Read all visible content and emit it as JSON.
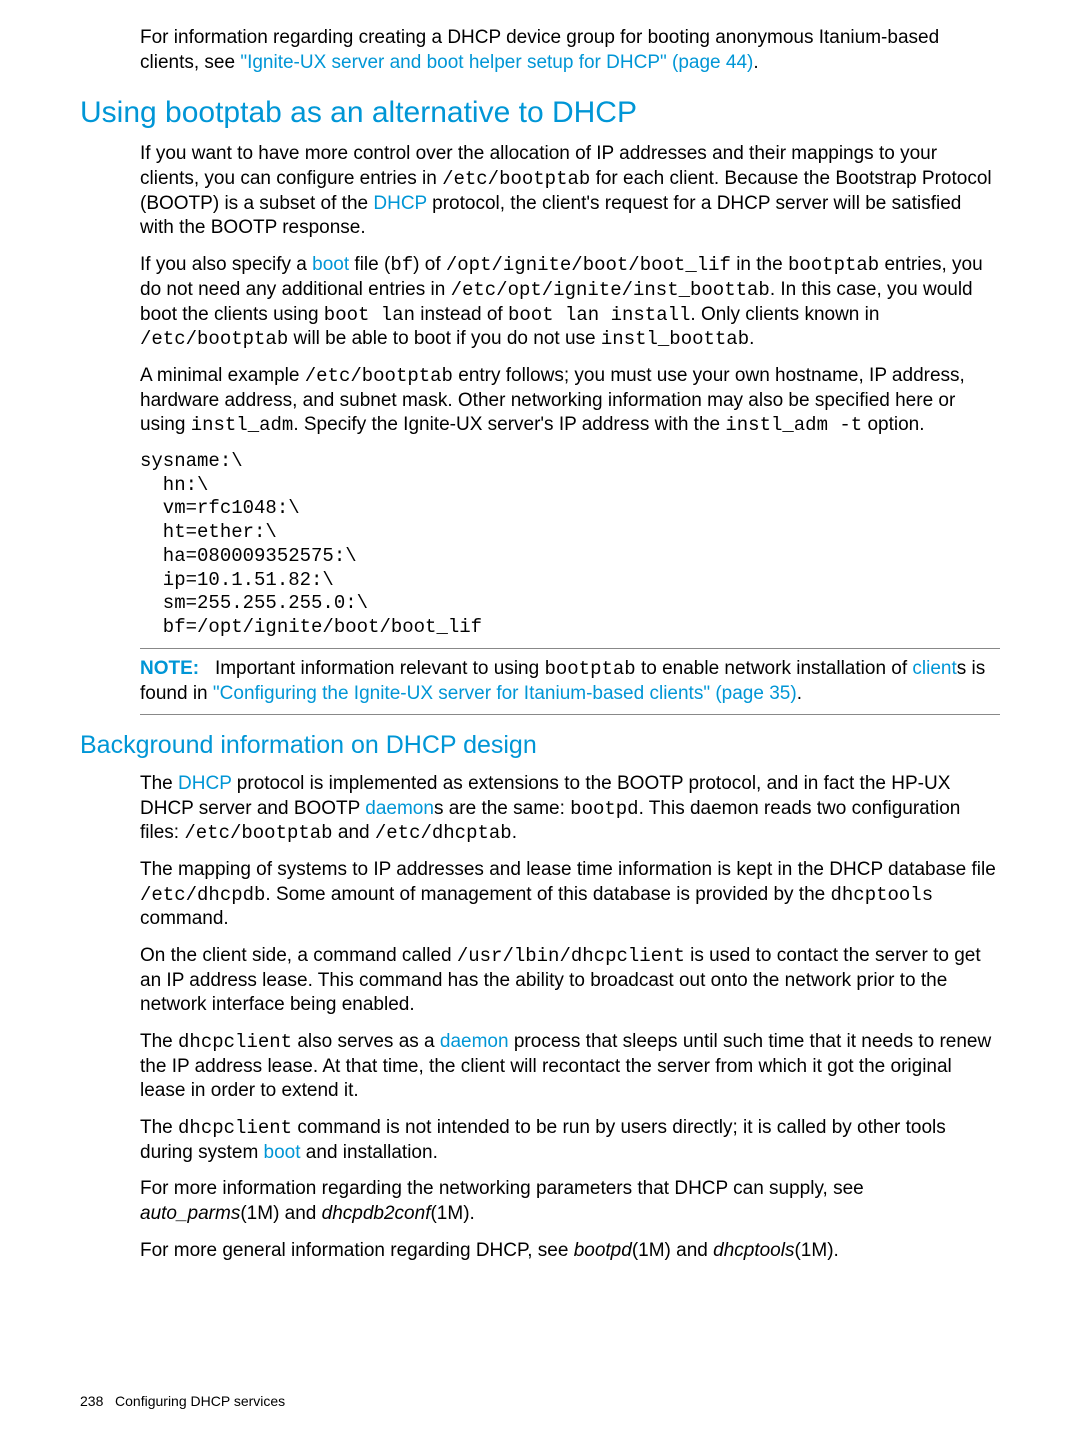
{
  "intro": {
    "p1_a": "For information regarding creating a DHCP device group for booting anonymous Itanium-based clients, see ",
    "p1_link": "\"Ignite-UX server and boot helper setup for DHCP\" (page 44)",
    "p1_b": "."
  },
  "section1": {
    "heading": "Using bootptab as an alternative to DHCP",
    "p1_a": "If you want to have more control over the allocation of IP addresses and their mappings to your clients, you can configure entries in ",
    "p1_code1": "/etc/bootptab",
    "p1_b": " for each client. Because the Bootstrap Protocol (BOOTP) is a subset of the ",
    "p1_link1": "DHCP",
    "p1_c": " protocol, the client's request for a DHCP server will be satisfied with the BOOTP response.",
    "p2_a": "If you also specify a ",
    "p2_link1": "boot",
    "p2_b": " file (",
    "p2_code1": "bf",
    "p2_c": ") of ",
    "p2_code2": "/opt/ignite/boot/boot_lif",
    "p2_d": " in the ",
    "p2_code3": "bootptab",
    "p2_e": " entries, you do not need any additional entries in ",
    "p2_code4": "/etc/opt/ignite/inst_boottab",
    "p2_f": ". In this case, you would boot the clients using ",
    "p2_code5": "boot lan",
    "p2_g": " instead of ",
    "p2_code6": "boot lan install",
    "p2_h": ". Only clients known in ",
    "p2_code7": "/etc/bootptab",
    "p2_i": " will be able to boot if you do not use ",
    "p2_code8": "instl_boottab",
    "p2_j": ".",
    "p3_a": "A minimal example ",
    "p3_code1": "/etc/bootptab",
    "p3_b": " entry follows; you must use your own hostname, IP address, hardware address, and subnet mask. Other networking information may also be specified here or using ",
    "p3_code2": "instl_adm",
    "p3_c": ". Specify the Ignite-UX server's IP address with the ",
    "p3_code3": "instl_adm -t",
    "p3_d": " option.",
    "code": "sysname:\\\n  hn:\\\n  vm=rfc1048:\\\n  ht=ether:\\\n  ha=080009352575:\\\n  ip=10.1.51.82:\\\n  sm=255.255.255.0:\\\n  bf=/opt/ignite/boot/boot_lif",
    "note_label": "NOTE:",
    "note_a": "Important information relevant to using ",
    "note_code1": "bootptab",
    "note_b": " to enable network installation of ",
    "note_link1": "client",
    "note_c": "s is found in ",
    "note_link2": "\"Configuring the Ignite-UX server for Itanium-based clients\" (page 35)",
    "note_d": "."
  },
  "section2": {
    "heading": "Background information on DHCP design",
    "p1_a": "The ",
    "p1_link1": "DHCP",
    "p1_b": " protocol is implemented as extensions to the BOOTP protocol, and in fact the HP-UX DHCP server and BOOTP ",
    "p1_link2": "daemon",
    "p1_c": "s are the same:  ",
    "p1_code1": "bootpd",
    "p1_d": ". This daemon reads two configuration files: ",
    "p1_code2": "/etc/bootptab",
    "p1_e": " and ",
    "p1_code3": "/etc/dhcptab",
    "p1_f": ".",
    "p2_a": "The mapping of systems to IP addresses and lease time information is kept in the DHCP database file ",
    "p2_code1": "/etc/dhcpdb",
    "p2_b": ". Some amount of management of this database is provided by the ",
    "p2_code2": "dhcptools",
    "p2_c": " command.",
    "p3_a": "On the client side, a command called ",
    "p3_code1": "/usr/lbin/dhcpclient",
    "p3_b": " is used to contact the server to get an IP address lease. This command has the ability to broadcast out onto the network prior to the network interface being enabled.",
    "p4_a": "The ",
    "p4_code1": "dhcpclient",
    "p4_b": " also serves as a ",
    "p4_link1": "daemon",
    "p4_c": " process that sleeps until such time that it needs to renew the IP address lease. At that time, the client will recontact the server from which it got the original lease in order to extend it.",
    "p5_a": "The ",
    "p5_code1": "dhcpclient",
    "p5_b": " command is not intended to be run by users directly; it is called by other tools during system ",
    "p5_link1": "boot",
    "p5_c": " and installation.",
    "p6_a": "For more information regarding the networking parameters that DHCP can supply, see ",
    "p6_i1": "auto_parms",
    "p6_b": "(1M) and ",
    "p6_i2": "dhcpdb2conf",
    "p6_c": "(1M).",
    "p7_a": "For more general information regarding DHCP, see ",
    "p7_i1": "bootpd",
    "p7_b": "(1M) and ",
    "p7_i2": "dhcptools",
    "p7_c": "(1M)."
  },
  "footer": {
    "pagenum": "238",
    "title": "Configuring DHCP services"
  }
}
